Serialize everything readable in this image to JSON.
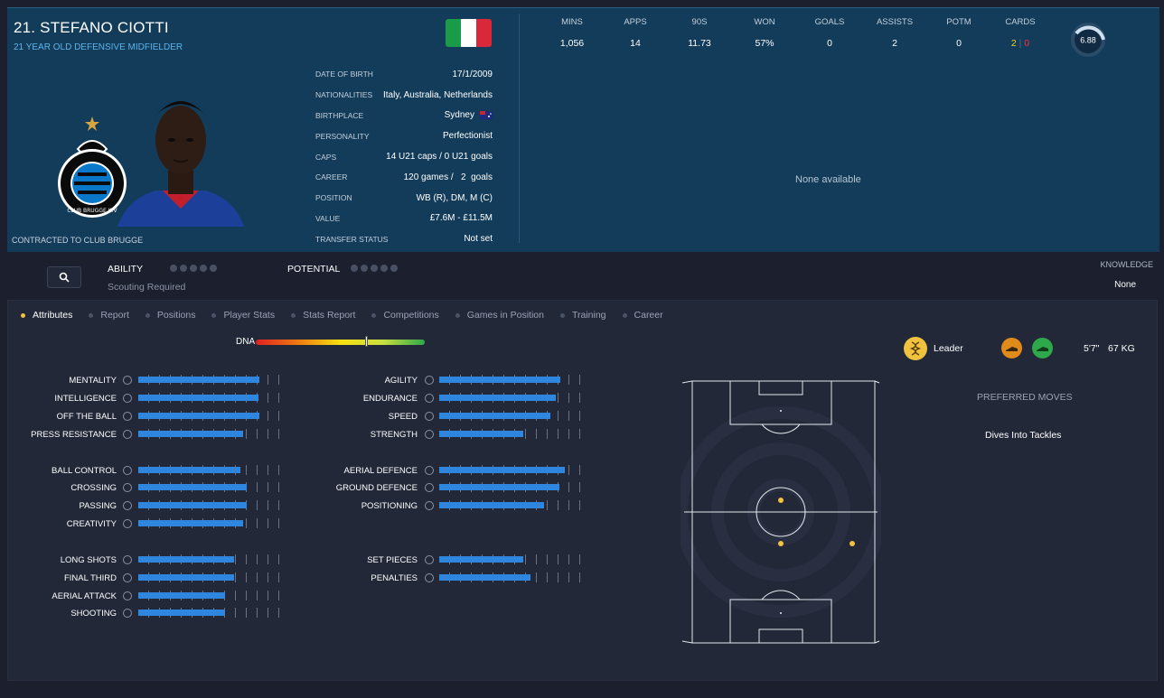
{
  "header": {
    "player_name": "21. STEFANO CIOTTI",
    "subtitle": "21 YEAR OLD DEFENSIVE MIDFIELDER",
    "contract": "CONTRACTED TO CLUB BRUGGE",
    "flag_colors": [
      "#1a9b48",
      "#ffffff",
      "#d8283a"
    ],
    "club_crest_text": "CLUB BRUGGE K.V",
    "details": [
      {
        "label": "DATE OF BIRTH",
        "value": "17/1/2009"
      },
      {
        "label": "NATIONALITIES",
        "value": "Italy, Australia, Netherlands"
      },
      {
        "label": "BIRTHPLACE",
        "value": "Sydney"
      },
      {
        "label": "PERSONALITY",
        "value": "Perfectionist"
      },
      {
        "label": "CAPS",
        "value": "14 U21 caps / 0 U21 goals"
      },
      {
        "label": "CAREER",
        "value": "120 games /   2  goals"
      },
      {
        "label": "POSITION",
        "value": "WB (R), DM, M (C)"
      },
      {
        "label": "VALUE",
        "value": "£7.6M - £11.5M"
      },
      {
        "label": "TRANSFER STATUS",
        "value": "Not set"
      }
    ]
  },
  "stats": {
    "columns": [
      {
        "label": "MINS",
        "value": "1,056"
      },
      {
        "label": "APPS",
        "value": "14"
      },
      {
        "label": "90S",
        "value": "11.73"
      },
      {
        "label": "WON",
        "value": "57%"
      },
      {
        "label": "GOALS",
        "value": "0"
      },
      {
        "label": "ASSISTS",
        "value": "2"
      },
      {
        "label": "POTM",
        "value": "0"
      },
      {
        "label": "CARDS",
        "value": ""
      }
    ],
    "cards_yellow": "2",
    "cards_red": "0",
    "rating": "6.88",
    "none_available": "None available"
  },
  "ability": {
    "ability_label": "ABILITY",
    "potential_label": "POTENTIAL",
    "scouting": "Scouting Required",
    "knowledge_label": "KNOWLEDGE",
    "knowledge_value": "None"
  },
  "tabs": [
    "Attributes",
    "Report",
    "Positions",
    "Player Stats",
    "Stats Report",
    "Competitions",
    "Games in Position",
    "Training",
    "Career"
  ],
  "dna": {
    "label": "DNA",
    "marker_fraction": 0.66
  },
  "attributes_left": [
    {
      "name": "MENTALITY",
      "value": 0.81
    },
    {
      "name": "INTELLIGENCE",
      "value": 0.8
    },
    {
      "name": "OFF THE BALL",
      "value": 0.81
    },
    {
      "name": "PRESS RESISTANCE",
      "value": 0.7
    },
    {
      "name": "BALL CONTROL",
      "value": 0.68
    },
    {
      "name": "CROSSING",
      "value": 0.72
    },
    {
      "name": "PASSING",
      "value": 0.72
    },
    {
      "name": "CREATIVITY",
      "value": 0.7
    },
    {
      "name": "LONG SHOTS",
      "value": 0.64
    },
    {
      "name": "FINAL THIRD",
      "value": 0.64
    },
    {
      "name": "AERIAL ATTACK",
      "value": 0.58
    },
    {
      "name": "SHOOTING",
      "value": 0.58
    }
  ],
  "attributes_right": [
    {
      "name": "AGILITY",
      "value": 0.81
    },
    {
      "name": "ENDURANCE",
      "value": 0.78
    },
    {
      "name": "SPEED",
      "value": 0.74
    },
    {
      "name": "STRENGTH",
      "value": 0.56
    },
    {
      "name": "AERIAL DEFENCE",
      "value": 0.84
    },
    {
      "name": "GROUND DEFENCE",
      "value": 0.8
    },
    {
      "name": "POSITIONING",
      "value": 0.7
    },
    {
      "name": "SET PIECES",
      "value": 0.56
    },
    {
      "name": "PENALTIES",
      "value": 0.61
    }
  ],
  "traits": {
    "leader": "Leader",
    "height": "5'7\"",
    "weight": "67 KG",
    "preferred_moves_label": "PREFERRED MOVES",
    "preferred_move": "Dives Into Tackles"
  },
  "colors": {
    "accent": "#2f86de",
    "gold": "#f0c240",
    "header_bg": "#123c59"
  }
}
